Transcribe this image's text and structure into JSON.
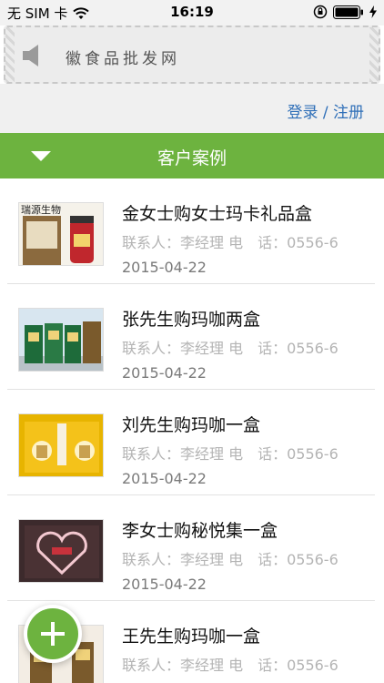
{
  "status_bar": {
    "carrier": "无 SIM 卡",
    "time": "16:19",
    "icons": [
      "wifi-icon",
      "rotation-lock-icon",
      "battery-icon",
      "charging-icon"
    ]
  },
  "notice": {
    "icon": "speaker-icon",
    "text": "徽食品批发网"
  },
  "login": {
    "label": "登录 / 注册"
  },
  "section": {
    "title": "客户案例",
    "icon": "triangle-down-icon",
    "color": "#6db33f"
  },
  "cases": [
    {
      "title": "金女士购女士玛卡礼品盒",
      "contact": "联系人：李经理 电　话：0556-6",
      "date": "2015-04-22",
      "thumb_text": "瑞源生物"
    },
    {
      "title": "张先生购玛咖两盒",
      "contact": "联系人：李经理 电　话：0556-6",
      "date": "2015-04-22",
      "thumb_text": ""
    },
    {
      "title": "刘先生购玛咖一盒",
      "contact": "联系人：李经理 电　话：0556-6",
      "date": "2015-04-22",
      "thumb_text": ""
    },
    {
      "title": "李女士购秘悦集一盒",
      "contact": "联系人：李经理 电　话：0556-6",
      "date": "2015-04-22",
      "thumb_text": ""
    },
    {
      "title": "王先生购玛咖一盒",
      "contact": "联系人：李经理 电　话：0556-6",
      "date": "",
      "thumb_text": ""
    }
  ],
  "fab": {
    "icon": "plus-icon"
  }
}
